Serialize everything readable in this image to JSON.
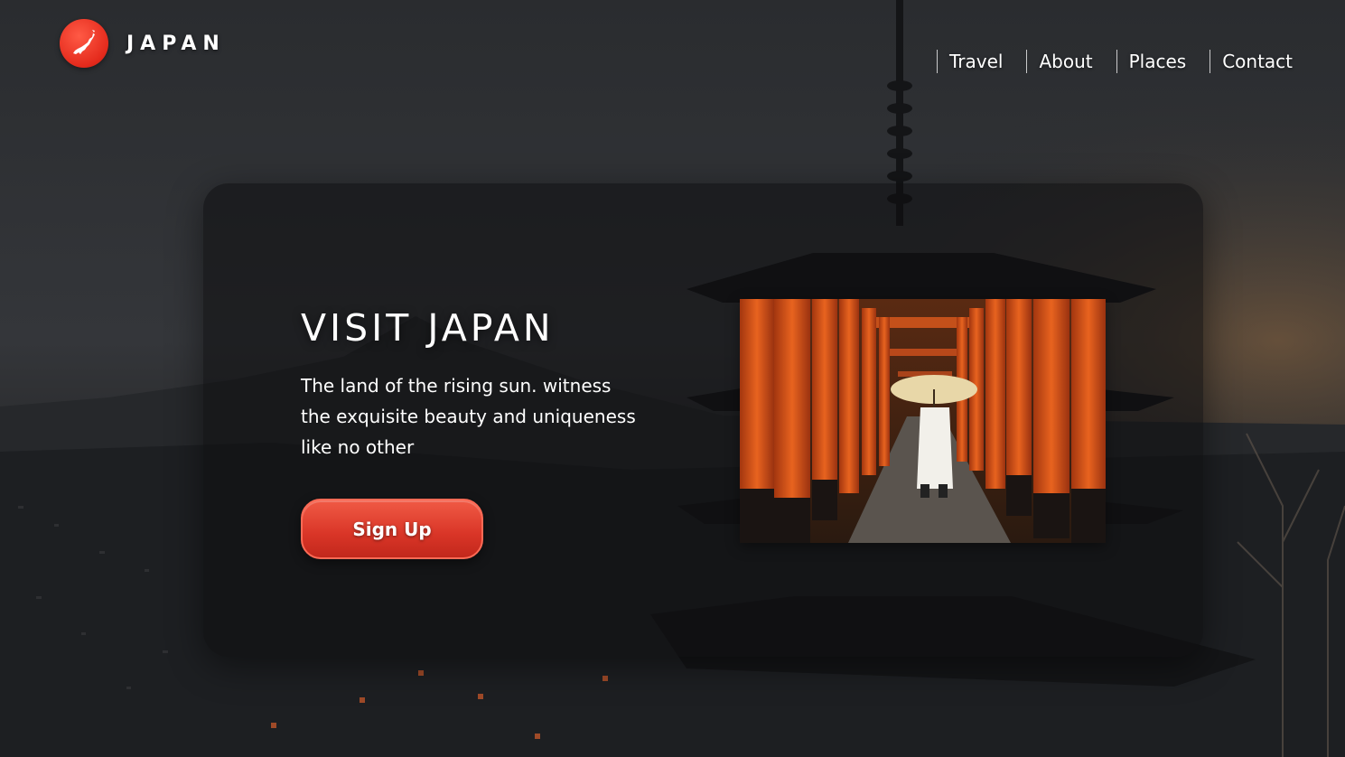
{
  "brand": {
    "name": "JAPAN",
    "logo_icon": "japan-map-icon"
  },
  "nav": {
    "items": [
      {
        "label": "Travel"
      },
      {
        "label": "About"
      },
      {
        "label": "Places"
      },
      {
        "label": "Contact"
      }
    ]
  },
  "hero": {
    "title": "VISIT JAPAN",
    "description": "The land of the rising sun. witness the exquisite beauty and uniqueness like no other",
    "cta_label": "Sign Up",
    "image_subject": "torii-gate-corridor-photo"
  },
  "colors": {
    "accent": "#e13a2a",
    "torii": "#d4501c",
    "background": "#1b1d20"
  }
}
